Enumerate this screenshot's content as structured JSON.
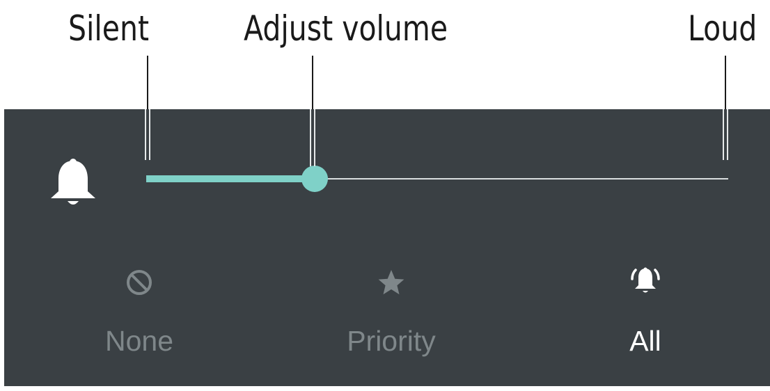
{
  "callouts": {
    "silent": "Silent",
    "adjust_volume": "Adjust volume",
    "loud": "Loud"
  },
  "panel": {
    "background_color": "#3a4044",
    "bell_icon": "bell-icon"
  },
  "volume_slider": {
    "level": 0.29,
    "fill_color": "#7fd1c8",
    "track_color": "#d9dedf"
  },
  "interruption_modes": {
    "selected": "All",
    "items": [
      {
        "label": "None",
        "icon": "no-entry-icon",
        "state": "inactive"
      },
      {
        "label": "Priority",
        "icon": "star-icon",
        "state": "inactive"
      },
      {
        "label": "All",
        "icon": "bell-ringing-icon",
        "state": "active"
      }
    ],
    "inactive_color": "#7f878a",
    "active_color": "#ffffff"
  }
}
